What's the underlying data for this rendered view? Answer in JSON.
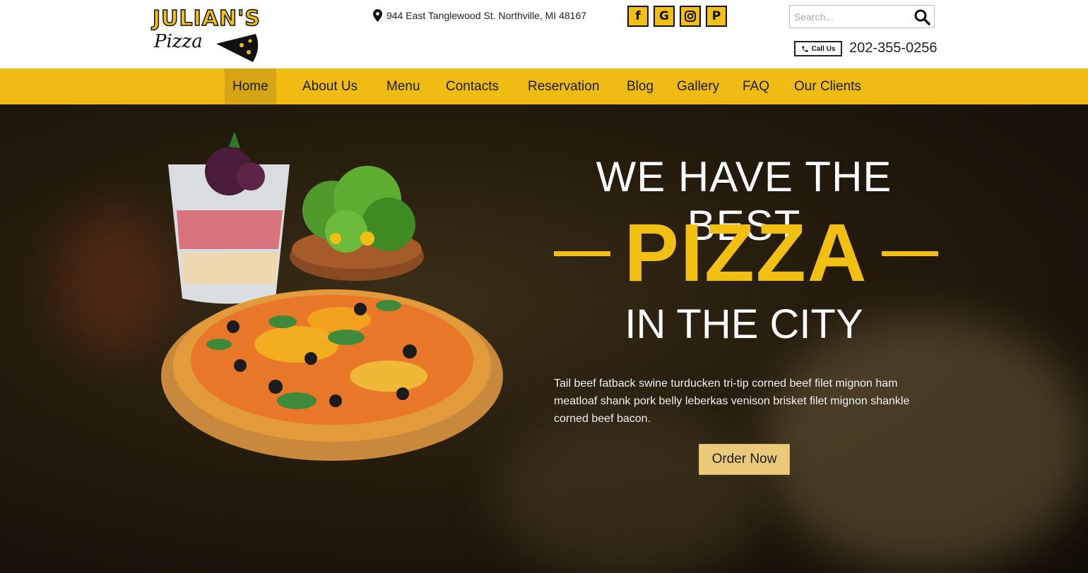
{
  "brand": {
    "name": "JULIAN'S",
    "script": "Pizza"
  },
  "header": {
    "address": "944 East Tanglewood St. Northville, MI 48167",
    "social": [
      {
        "icon": "facebook-icon",
        "glyph": "f"
      },
      {
        "icon": "google-icon",
        "glyph": "G"
      },
      {
        "icon": "instagram-icon",
        "glyph": ""
      },
      {
        "icon": "pinterest-icon",
        "glyph": "P"
      }
    ],
    "search": {
      "placeholder": "Search..."
    },
    "call_label": "Call Us",
    "phone": "202-355-0256"
  },
  "nav": {
    "items": [
      {
        "label": "Home",
        "active": true
      },
      {
        "label": "About Us"
      },
      {
        "label": "Menu"
      },
      {
        "label": "Contacts"
      },
      {
        "label": "Reservation"
      },
      {
        "label": "Blog"
      },
      {
        "label": "Gallery"
      },
      {
        "label": "FAQ"
      },
      {
        "label": "Our Clients"
      }
    ]
  },
  "hero": {
    "line1": "WE HAVE  THE BEST",
    "highlight": "PIZZA",
    "line3": "IN THE CITY",
    "description": "Tail beef fatback swine turducken tri-tip corned beef filet mignon ham meatloaf shank pork belly leberkas venison  brisket filet mignon shankle corned beef bacon.",
    "cta": "Order Now"
  },
  "colors": {
    "accent": "#f0bc14",
    "nav_active": "#d6a514",
    "cta": "#eac97a",
    "hero_bg": "#241b0d"
  }
}
